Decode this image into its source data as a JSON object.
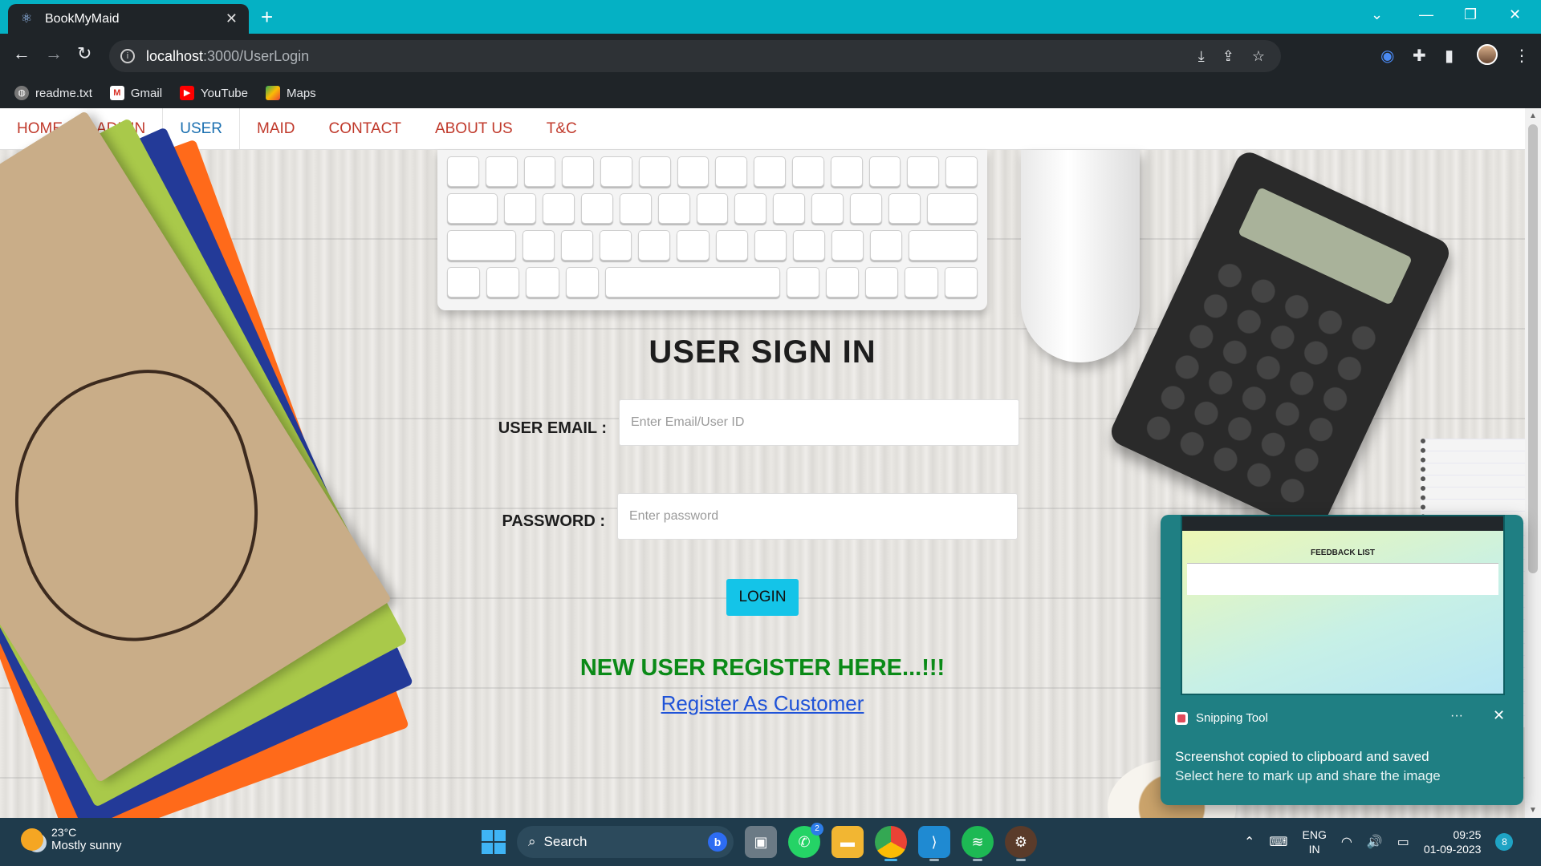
{
  "browser": {
    "tab_title": "BookMyMaid",
    "url_host": "localhost",
    "url_path": ":3000/UserLogin",
    "bookmarks": [
      {
        "label": "readme.txt",
        "icon": "globe-icon"
      },
      {
        "label": "Gmail",
        "icon": "gmail-icon"
      },
      {
        "label": "YouTube",
        "icon": "youtube-icon"
      },
      {
        "label": "Maps",
        "icon": "maps-icon"
      }
    ]
  },
  "nav": {
    "items": [
      {
        "label": "HOME"
      },
      {
        "label": "ADMIN"
      },
      {
        "label": "USER"
      },
      {
        "label": "MAID"
      },
      {
        "label": "CONTACT"
      },
      {
        "label": "ABOUT US"
      },
      {
        "label": "T&C"
      }
    ],
    "active": "USER"
  },
  "form": {
    "title": "USER SIGN IN",
    "email_label": "USER EMAIL :",
    "email_placeholder": "Enter Email/User ID",
    "email_value": "",
    "password_label": "PASSWORD :",
    "password_placeholder": "Enter password",
    "password_value": "",
    "login_label": "LOGIN",
    "register_heading": "NEW USER REGISTER HERE...!!!",
    "register_link": "Register As Customer"
  },
  "toast": {
    "app_name": "Snipping Tool",
    "preview_title": "FEEDBACK LIST",
    "message_title": "Screenshot copied to clipboard and saved",
    "message_body": "Select here to mark up and share the image",
    "more": "···",
    "close": "✕"
  },
  "taskbar": {
    "temperature": "23°C",
    "weather": "Mostly sunny",
    "search_label": "Search",
    "whatsapp_badge": "2",
    "lang_line1": "ENG",
    "lang_line2": "IN",
    "time": "09:25",
    "date": "01-09-2023",
    "notification_count": "8"
  },
  "colors": {
    "tab_bar": "#05b1c4",
    "nav_link": "#c0392b",
    "nav_active": "#1a6fb0",
    "login_button": "#14c4e8",
    "register_heading": "#0a8a17",
    "register_link": "#1f53d8"
  }
}
